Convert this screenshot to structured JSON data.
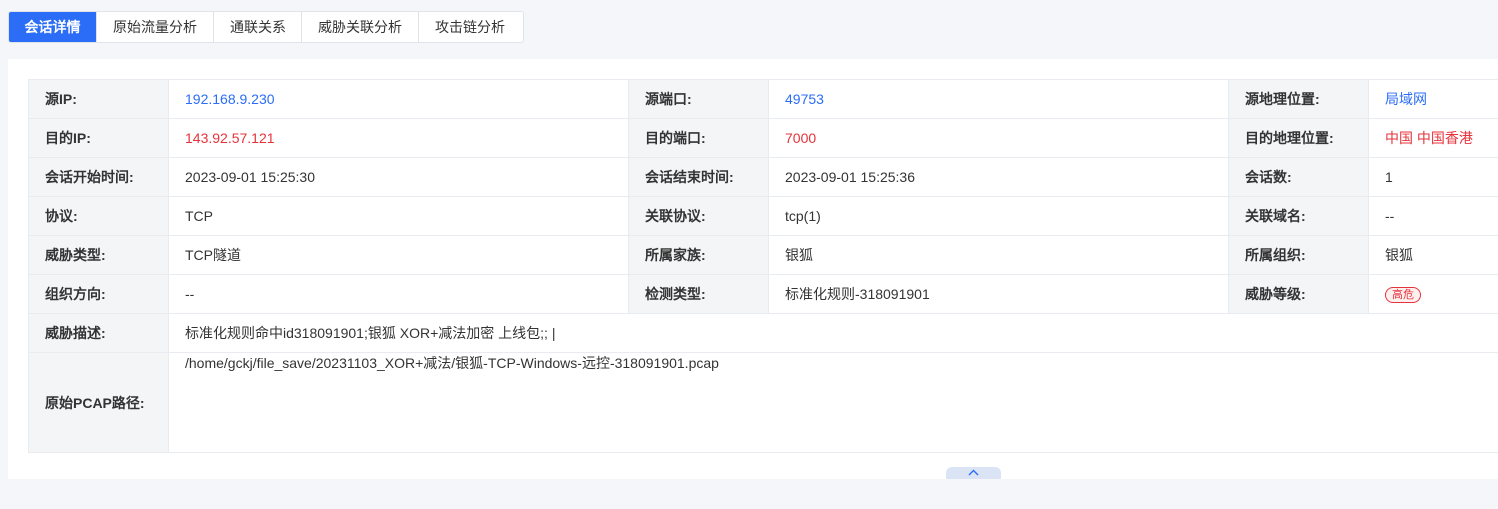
{
  "tabs": [
    {
      "label": "会话详情",
      "active": true
    },
    {
      "label": "原始流量分析",
      "active": false
    },
    {
      "label": "通联关系",
      "active": false
    },
    {
      "label": "威胁关联分析",
      "active": false
    },
    {
      "label": "攻击链分析",
      "active": false
    }
  ],
  "detail": {
    "src_ip": {
      "label": "源IP:",
      "value": "192.168.9.230"
    },
    "src_port": {
      "label": "源端口:",
      "value": "49753"
    },
    "src_geo": {
      "label": "源地理位置:",
      "value": "局域网"
    },
    "dst_ip": {
      "label": "目的IP:",
      "value": "143.92.57.121"
    },
    "dst_port": {
      "label": "目的端口:",
      "value": "7000"
    },
    "dst_geo": {
      "label": "目的地理位置:",
      "value": "中国 中国香港"
    },
    "start_time": {
      "label": "会话开始时间:",
      "value": "2023-09-01 15:25:30"
    },
    "end_time": {
      "label": "会话结束时间:",
      "value": "2023-09-01 15:25:36"
    },
    "session_count": {
      "label": "会话数:",
      "value": "1"
    },
    "protocol": {
      "label": "协议:",
      "value": "TCP"
    },
    "related_protocol": {
      "label": "关联协议:",
      "value": "tcp(1)"
    },
    "related_domain": {
      "label": "关联域名:",
      "value": "--"
    },
    "threat_type": {
      "label": "威胁类型:",
      "value": "TCP隧道"
    },
    "family": {
      "label": "所属家族:",
      "value": "银狐"
    },
    "organization": {
      "label": "所属组织:",
      "value": "银狐"
    },
    "org_direction": {
      "label": "组织方向:",
      "value": "--"
    },
    "detect_type": {
      "label": "检测类型:",
      "value": "标准化规则-318091901"
    },
    "threat_level": {
      "label": "威胁等级:",
      "value": "高危"
    },
    "threat_desc": {
      "label": "威胁描述:",
      "value": "标准化规则命中id318091901;银狐 XOR+减法加密 上线包;; |"
    },
    "pcap_path": {
      "label": "原始PCAP路径:",
      "value": "/home/gckj/file_save/20231103_XOR+减法/银狐-TCP-Windows-远控-318091901.pcap"
    }
  },
  "colors": {
    "accent": "#2b6df6",
    "danger": "#e5333b",
    "label_bg": "#f4f5f7"
  }
}
